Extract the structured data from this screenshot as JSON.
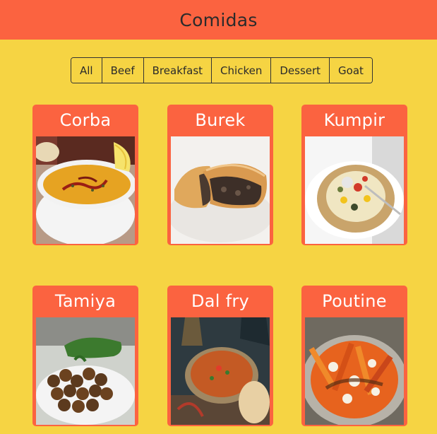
{
  "header": {
    "title": "Comidas"
  },
  "filters": [
    "All",
    "Beef",
    "Breakfast",
    "Chicken",
    "Dessert",
    "Goat"
  ],
  "meals": [
    {
      "name": "Corba"
    },
    {
      "name": "Burek"
    },
    {
      "name": "Kumpir"
    },
    {
      "name": "Tamiya"
    },
    {
      "name": "Dal fry"
    },
    {
      "name": "Poutine"
    }
  ],
  "colors": {
    "background": "#f6d443",
    "header": "#fb6340",
    "card": "#fb6340"
  }
}
